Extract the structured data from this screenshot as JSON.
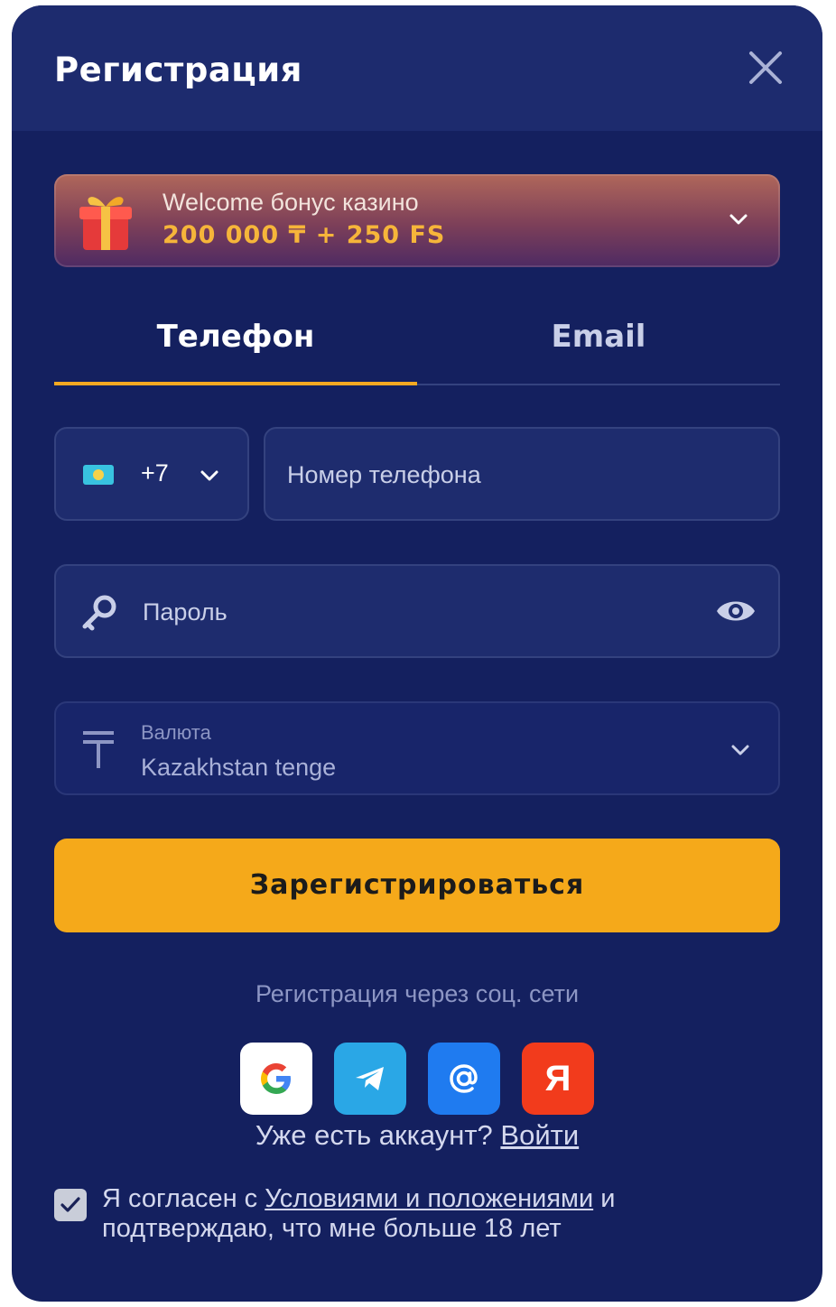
{
  "header": {
    "title": "Регистрация"
  },
  "bonus": {
    "line1": "Welcome бонус казино",
    "line2": "200 000 ₸ + 250 FS"
  },
  "tabs": [
    {
      "label": "Телефон",
      "active": true
    },
    {
      "label": "Email",
      "active": false
    }
  ],
  "phone": {
    "country_code": "+7",
    "placeholder": "Номер телефона"
  },
  "password": {
    "placeholder": "Пароль"
  },
  "currency": {
    "label": "Валюта",
    "value": "Kazakhstan tenge"
  },
  "submit": {
    "label": "Зарегистрироваться"
  },
  "social": {
    "label": "Регистрация через соц. сети",
    "providers": [
      {
        "icon": "google-icon",
        "color": "#ffffff"
      },
      {
        "icon": "telegram-icon",
        "color": "#2aa7e6"
      },
      {
        "icon": "mail-at-icon",
        "color": "#1f7bf0"
      },
      {
        "icon": "yandex-icon",
        "color": "#f23b1c",
        "letter": "Я"
      }
    ]
  },
  "account": {
    "text": "Уже есть аккаунт?",
    "login_link": "Войти"
  },
  "agreement": {
    "checked": true,
    "before": "Я согласен с",
    "link": "Условиями и положениями",
    "after": "и подтверждаю, что мне больше 18 лет"
  },
  "colors": {
    "modal_bg": "#14205f",
    "accent": "#f5a91a",
    "tab_underline": "#f5a922"
  }
}
